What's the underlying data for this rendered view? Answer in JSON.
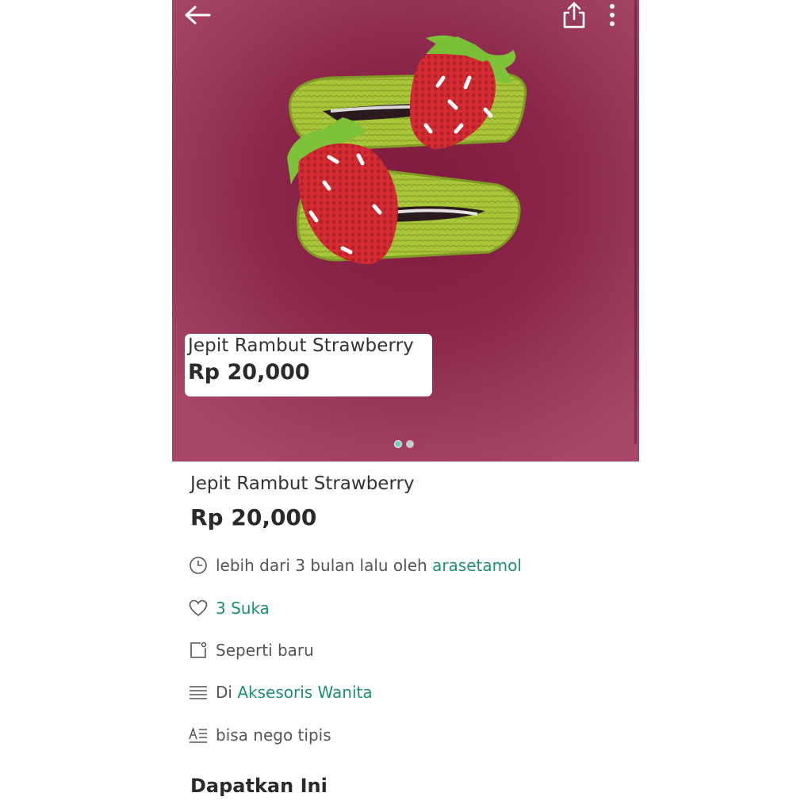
{
  "topbar": {
    "back_icon": "arrow-left-icon",
    "share_icon": "share-icon",
    "more_icon": "more-vertical-icon"
  },
  "hero": {
    "image_subject": "two crocheted strawberry hair clips",
    "overlay_title": "Jepit Rambut Strawberry",
    "overlay_price": "Rp 20,000",
    "carousel_pages": 2,
    "carousel_active": 1
  },
  "product": {
    "title": "Jepit Rambut Strawberry",
    "price": "Rp 20,000"
  },
  "details": {
    "posted_text": "lebih dari 3 bulan lalu oleh",
    "seller": "arasetamol",
    "likes": "3 Suka",
    "condition": "Seperti baru",
    "category_prefix": "Di",
    "category": "Aksesoris Wanita",
    "note": "bisa nego tipis"
  },
  "section": {
    "get_this": "Dapatkan Ini"
  },
  "colors": {
    "accent": "#1c8f76",
    "hero_bg": "#8a2649",
    "text": "#2b2b2b"
  }
}
